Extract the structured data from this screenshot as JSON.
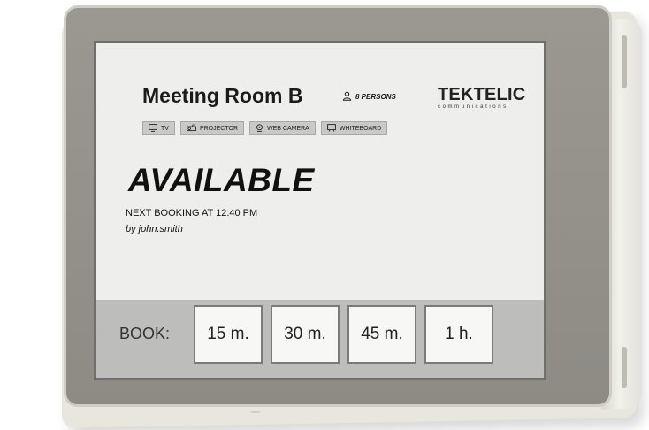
{
  "room": {
    "title": "Meeting Room B",
    "capacity": "8 PERSONS",
    "capacity_icon": "person-icon"
  },
  "brand": {
    "name": "TEKTELIC",
    "tagline": "communications"
  },
  "amenities": [
    {
      "label": "TV",
      "icon": "tv-icon"
    },
    {
      "label": "PROJECTOR",
      "icon": "projector-icon"
    },
    {
      "label": "WEB CAMERA",
      "icon": "webcam-icon"
    },
    {
      "label": "WHITEBOARD",
      "icon": "whiteboard-icon"
    }
  ],
  "status": {
    "text": "AVAILABLE",
    "next_booking": "NEXT BOOKING AT 12:40 PM",
    "booked_by": "by john.smith"
  },
  "booking": {
    "label": "BOOK:",
    "options": [
      "15 m.",
      "30 m.",
      "45 m.",
      "1 h."
    ]
  },
  "colors": {
    "screen_bg": "#eeeeec",
    "bezel": "#8d8b84",
    "button_bg": "#f7f7f5",
    "book_bar": "#bdbdbb"
  }
}
